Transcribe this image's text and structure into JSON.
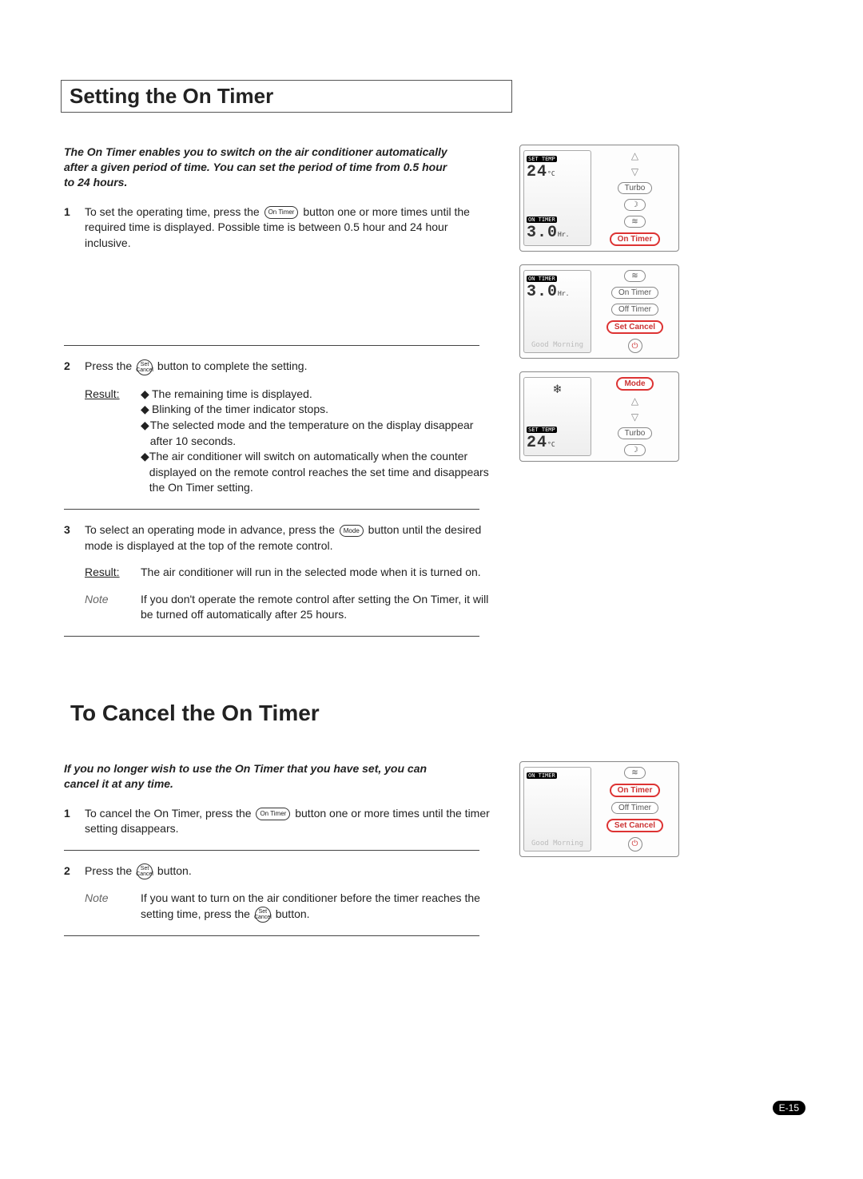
{
  "section1": {
    "title": "Setting the On Timer",
    "intro": "The On Timer enables you to switch on the air conditioner automatically after a given period of time. You can set the period of time from 0.5 hour to 24 hours.",
    "steps": [
      {
        "num": "1",
        "text_before": "To set the operating time, press the ",
        "btn": "On Timer",
        "text_after": " button one or more times until the required time is displayed. Possible time is between 0.5 hour and 24 hour inclusive."
      },
      {
        "num": "2",
        "text_before": "Press the ",
        "btn": "Set Cancel",
        "text_after": " button to complete the setting.",
        "result_label": "Result:",
        "results": [
          "The remaining time is displayed.",
          "Blinking of the timer indicator stops.",
          "The selected mode and the temperature on the display disappear after 10 seconds.",
          "The air conditioner will switch on automatically when the counter displayed on the remote control reaches the set time and disappears the On Timer setting."
        ]
      },
      {
        "num": "3",
        "text_before": "To select an operating mode in advance, press the ",
        "btn": "Mode",
        "text_after": " button until the desired mode is displayed at the top of the remote control.",
        "result_label": "Result:",
        "result_text": "The air conditioner will run in the selected mode when it is turned on.",
        "note_label": "Note",
        "note_text": "If you don't operate the remote control after setting the On Timer, it will be turned off automatically after 25 hours."
      }
    ]
  },
  "section2": {
    "title": "To Cancel the On Timer",
    "intro": "If you no longer wish to use the On Timer that you have set, you can cancel it at any time.",
    "steps": [
      {
        "num": "1",
        "text_before": "To cancel the On Timer, press the ",
        "btn": "On Timer",
        "text_after": " button one or more times until the timer setting disappears."
      },
      {
        "num": "2",
        "text_before": "Press the ",
        "btn": "Set Cancel",
        "text_after": " button.",
        "note_label": "Note",
        "note_before": "If you want to turn on the air conditioner before the timer reaches the setting time, press the ",
        "note_btn": "Set Cancel",
        "note_after": " button."
      }
    ]
  },
  "remote": {
    "set_temp_tag": "SET TEMP",
    "temp": "24",
    "temp_unit": "°C",
    "on_timer_tag": "ON TIMER",
    "timer_value": "3.0",
    "timer_unit": "Hr.",
    "good_morning": "Good Morning",
    "buttons": {
      "turbo": "Turbo",
      "on_timer": "On Timer",
      "off_timer": "Off Timer",
      "set_cancel_line1": "Set",
      "set_cancel_line2": "Cancel",
      "mode": "Mode"
    }
  },
  "page_number": "E-15"
}
